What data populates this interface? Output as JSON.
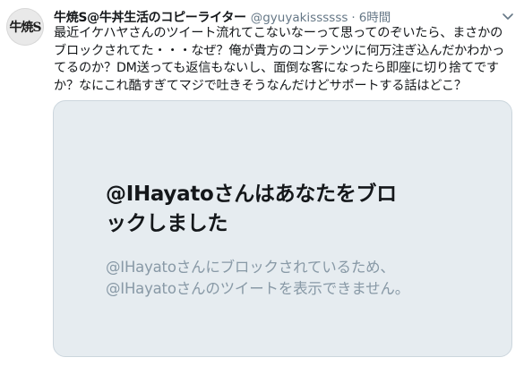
{
  "tweet": {
    "avatar_text": "牛焼S",
    "display_name": "牛焼S@牛丼生活のコピーライター",
    "handle": "@gyuyakissssss",
    "separator": "·",
    "time": "6時間",
    "body_lines": [
      "最近イケハヤさんのツイート流れてこないなーって思ってのぞいたら、まさかの",
      "ブロックされてた・・・なぜ？俺が貴方のコンテンツに何万注ぎ込んだかわかっ",
      "てるのか？DM送っても返信もないし、面倒な客になったら即座に切り捨てです",
      "か？なにこれ酷すぎてマジで吐きそうなんだけどサポートする話はどこ？"
    ]
  },
  "blocked_card": {
    "title_lines": [
      "@IHayatoさんはあなたをブロ",
      "ックしました"
    ],
    "subtitle_lines": [
      "@IHayatoさんにブロックされているため、",
      "@IHayatoさんのツイートを表示できません。"
    ]
  },
  "colors": {
    "text": "#14171a",
    "secondary": "#657786",
    "card_bg": "#e6ecf0",
    "card_border": "#ccd6dd",
    "card_sub": "#8899a6"
  },
  "icons": {
    "caret": "chevron-down-icon"
  }
}
